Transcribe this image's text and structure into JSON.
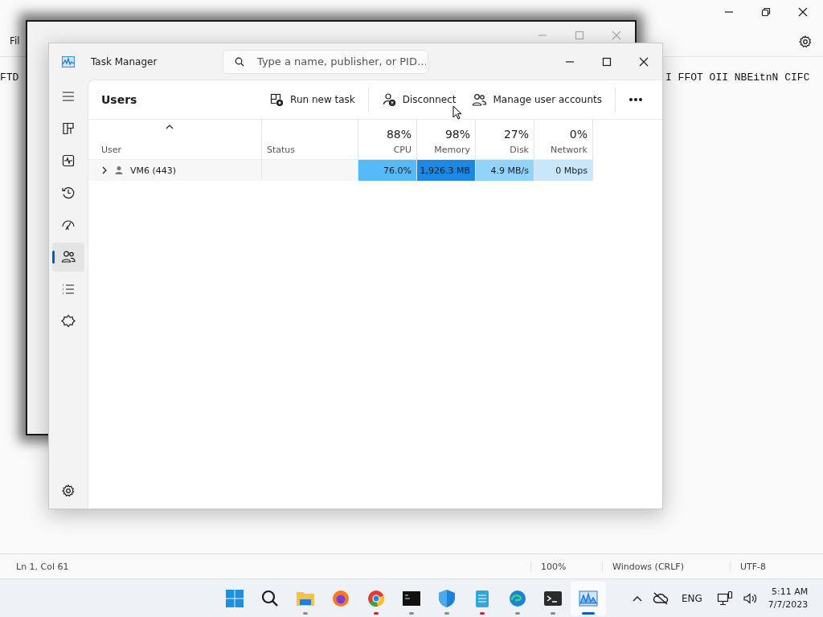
{
  "notepad": {
    "menu": [
      "Fil"
    ],
    "text_left": "FTD",
    "text_right": "I FFOT OII NBEitnN CIFC",
    "status_bar": [
      "Ln 1, Col 61",
      "100%",
      "Windows (CRLF)",
      "UTF-8"
    ]
  },
  "task_manager": {
    "title": "Task Manager",
    "search": {
      "placeholder": "Type a name, publisher, or PID…"
    },
    "nav": [
      {
        "kind": "processes",
        "selected": false
      },
      {
        "kind": "performance",
        "selected": false
      },
      {
        "kind": "history",
        "selected": false
      },
      {
        "kind": "startup",
        "selected": false
      },
      {
        "kind": "users",
        "selected": true
      },
      {
        "kind": "details",
        "selected": false
      },
      {
        "kind": "services",
        "selected": false
      }
    ],
    "page_title": "Users",
    "actions": [
      {
        "kind": "run",
        "label": "Run new task"
      },
      {
        "kind": "disconnect",
        "label": "Disconnect"
      },
      {
        "kind": "accounts",
        "label": "Manage user accounts"
      }
    ],
    "columns": [
      {
        "label": "User"
      },
      {
        "label": "Status"
      },
      {
        "label": "CPU",
        "percent": "88%"
      },
      {
        "label": "Memory",
        "percent": "98%"
      },
      {
        "label": "Disk",
        "percent": "27%"
      },
      {
        "label": "Network",
        "percent": "0%"
      }
    ],
    "rows": [
      {
        "cells": [
          {
            "text": "VM6 (443)",
            "expanded": false
          },
          {
            "text": ""
          },
          {
            "text": "76.0%",
            "color": "#55baf7"
          },
          {
            "text": "1,926.3 MB",
            "color": "#1c88e6"
          },
          {
            "text": "4.9 MB/s",
            "color": "#90d2fa"
          },
          {
            "text": "0 Mbps",
            "color": "#c8e7fb"
          }
        ]
      }
    ]
  },
  "taskbar": {
    "apps": [
      {
        "kind": "start"
      },
      {
        "kind": "search"
      },
      {
        "kind": "folder",
        "running": true,
        "attention": false,
        "active": false
      },
      {
        "kind": "firefox",
        "running": false
      },
      {
        "kind": "chrome",
        "running": true,
        "attention": true,
        "active": false
      },
      {
        "kind": "cmd",
        "running": true,
        "attention": false,
        "active": false
      },
      {
        "kind": "shield",
        "running": true,
        "attention": false,
        "active": false
      },
      {
        "kind": "notepad",
        "running": true,
        "attention": true,
        "active": false
      },
      {
        "kind": "edge",
        "running": true,
        "attention": false,
        "active": false
      },
      {
        "kind": "terminal",
        "running": true,
        "attention": false,
        "active": false
      },
      {
        "kind": "taskmgr",
        "running": true,
        "active": true
      }
    ],
    "language": "ENG",
    "time": "5:11 AM",
    "date": "7/7/2023"
  }
}
